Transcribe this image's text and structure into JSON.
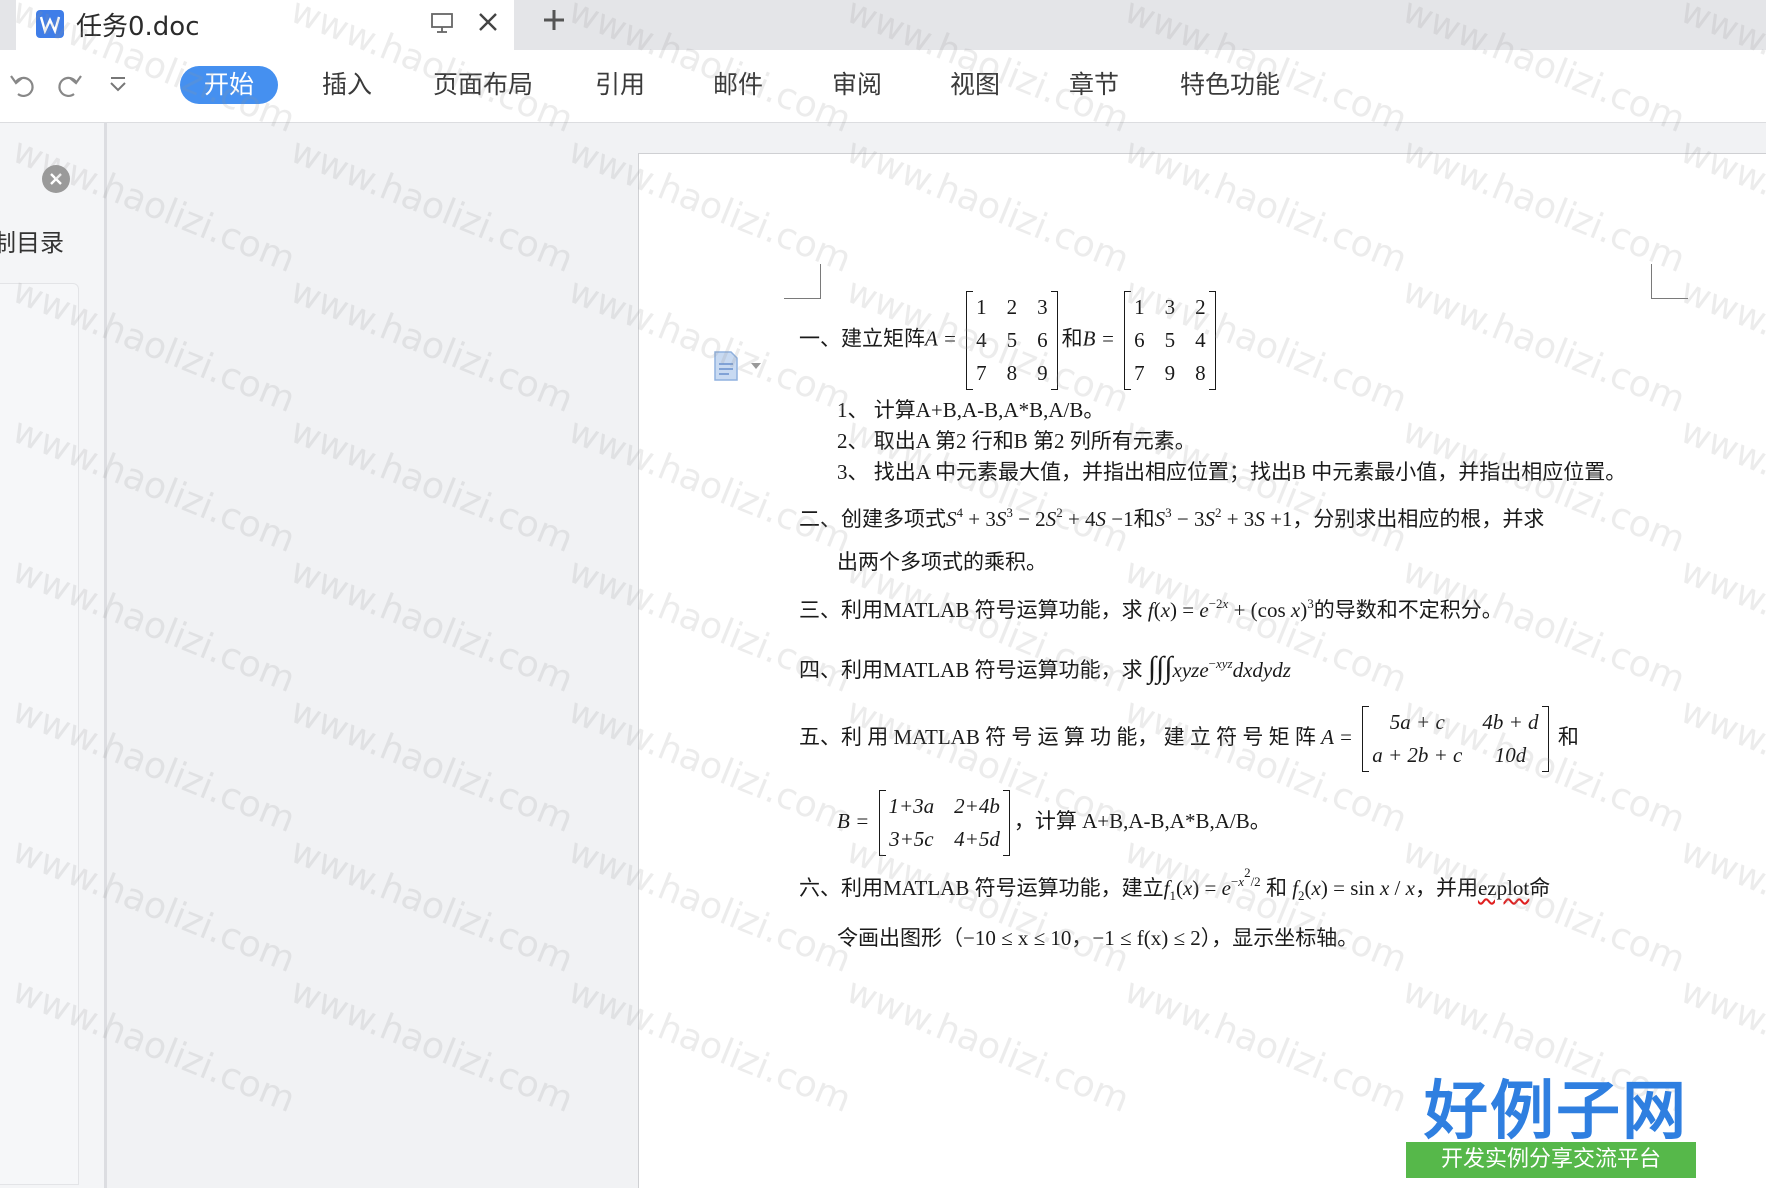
{
  "tab": {
    "title": "任务0.doc",
    "new_tab": "+"
  },
  "ribbon": {
    "menus": [
      "开始",
      "插入",
      "页面布局",
      "引用",
      "邮件",
      "审阅",
      "视图",
      "章节",
      "特色功能"
    ]
  },
  "nav": {
    "label": "制目录"
  },
  "document": {
    "q1": {
      "prefix": "一、建立矩阵",
      "A_label": "A =",
      "and": "和",
      "B_label": "B =",
      "A": [
        [
          "1",
          "2",
          "3"
        ],
        [
          "4",
          "5",
          "6"
        ],
        [
          "7",
          "8",
          "9"
        ]
      ],
      "B": [
        [
          "1",
          "3",
          "2"
        ],
        [
          "6",
          "5",
          "4"
        ],
        [
          "7",
          "9",
          "8"
        ]
      ]
    },
    "q1_items": [
      "1、 计算A+B,A-B,A*B,A/B。",
      "2、 取出A 第2 行和B 第2 列所有元素。",
      "3、 找出A 中元素最大值，并指出相应位置；找出B 中元素最小值，并指出相应位置。"
    ],
    "q2": {
      "prefix": "二、创建多项式",
      "mid": "和",
      "suffix": "，分别求出相应的根，并求",
      "line2": "出两个多项式的乘积。"
    },
    "q3": {
      "prefix": "三、利用MATLAB 符号运算功能，求",
      "suffix": "的导数和不定积分。"
    },
    "q4": {
      "prefix": "四、利用MATLAB 符号运算功能，求"
    },
    "q5": {
      "prefix": "五、利 用 MATLAB 符 号 运 算 功 能， 建 立 符 号 矩 阵",
      "A_label": "A =",
      "and": "和",
      "A": [
        [
          "5a + c",
          "4b + d"
        ],
        [
          "a + 2b + c",
          "10d"
        ]
      ],
      "B_label": "B =",
      "B": [
        [
          "1+3a",
          "2+4b"
        ],
        [
          "3+5c",
          "4+5d"
        ]
      ],
      "suffix": "，计算 A+B,A-B,A*B,A/B。"
    },
    "q6": {
      "prefix": "六、利用MATLAB 符号运算功能，建立",
      "and": "和",
      "mid": "，并用",
      "cmd": "ezplot",
      "suffix": "命",
      "line2": "令画出图形（−10 ≤ x ≤ 10，−1 ≤ f(x) ≤ 2），显示坐标轴。"
    }
  },
  "watermark": {
    "text": "www.haolizi.com"
  },
  "logo": {
    "title": "好例子网",
    "subtitle": "开发实例分享交流平台"
  },
  "colors": {
    "accent": "#4590f0",
    "logo_blue": "#2f7fe0",
    "logo_green": "#56b84a"
  },
  "icons": [
    "word-doc-icon",
    "monitor-icon",
    "close-icon",
    "plus-icon",
    "undo-icon",
    "redo-icon",
    "dropdown-icon",
    "paragraph-icon"
  ]
}
